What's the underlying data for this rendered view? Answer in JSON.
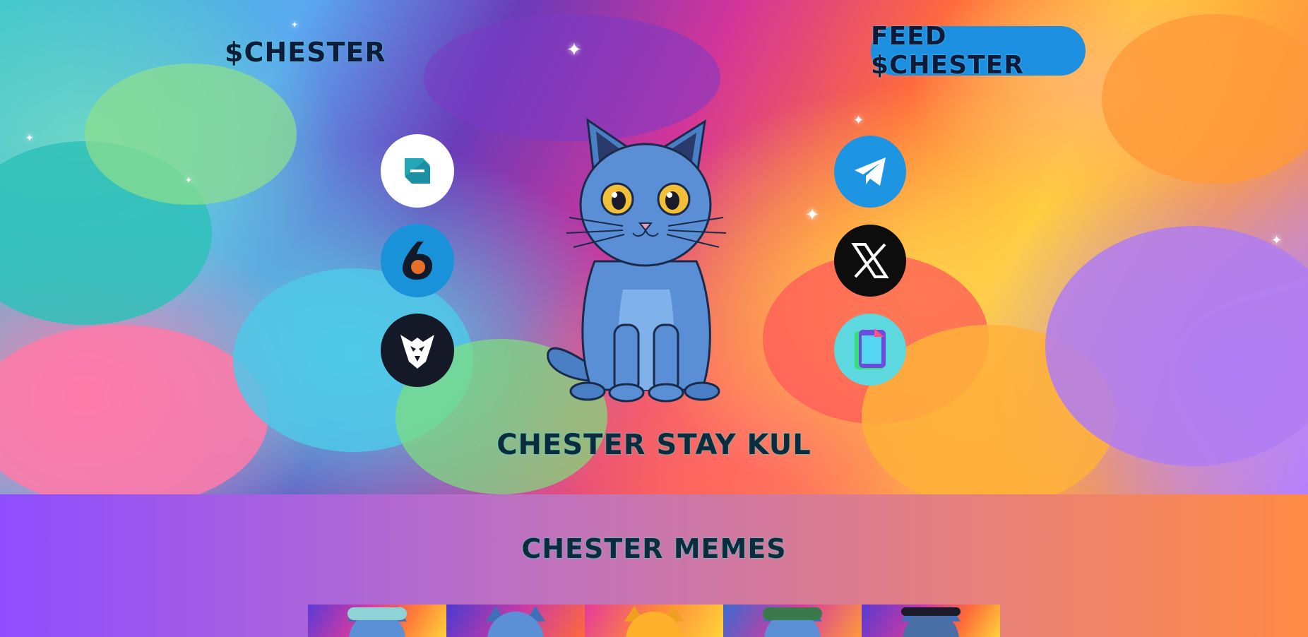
{
  "header": {
    "brand": "$CHESTER",
    "feed_button": "FEED $CHESTER"
  },
  "socials_left": [
    {
      "name": "dextools-icon"
    },
    {
      "name": "birdeye-icon"
    },
    {
      "name": "eagle-icon"
    }
  ],
  "socials_right": [
    {
      "name": "telegram-icon"
    },
    {
      "name": "x-icon"
    },
    {
      "name": "pump-pill-icon"
    }
  ],
  "hero": {
    "headline": "CHESTER STAY KUL"
  },
  "memes": {
    "title": "CHESTER MEMES",
    "thumbs": [
      {
        "variant": "floral-hat"
      },
      {
        "variant": "plain"
      },
      {
        "variant": "orange-cat"
      },
      {
        "variant": "green-cap"
      },
      {
        "variant": "tiara"
      }
    ]
  },
  "colors": {
    "feed_button_bg": "#1d8fe1",
    "text_dark": "#0e1a3a",
    "text_glow": "#3fe3d1",
    "memes_gradient_start": "#8f4dff",
    "memes_gradient_end": "#ff8a45"
  }
}
